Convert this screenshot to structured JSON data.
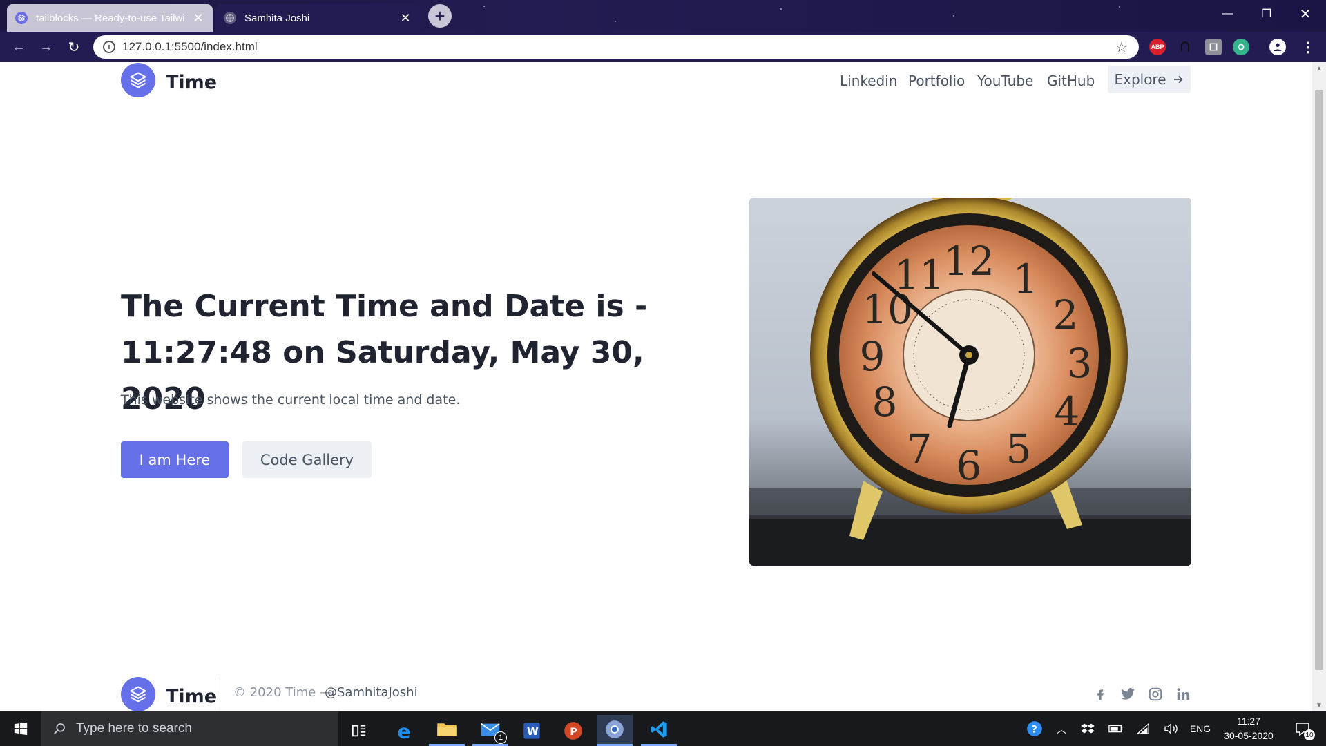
{
  "browser": {
    "tabs": [
      {
        "title": "tailblocks — Ready-to-use Tailwi",
        "active": false
      },
      {
        "title": "Samhita Joshi",
        "active": true
      }
    ],
    "url": "127.0.0.1:5500/index.html",
    "extensions": [
      {
        "name": "adblock-plus-icon",
        "label": "ABP"
      }
    ]
  },
  "header": {
    "brand": "Time",
    "nav": [
      "Linkedin",
      "Portfolio",
      "YouTube",
      "GitHub"
    ],
    "explore_label": "Explore",
    "explore_icon": "arrow-right-icon"
  },
  "hero": {
    "heading_line1": "The Current Time and Date is -",
    "heading_line2": "11:27:48 on Saturday, May 30, 2020",
    "subtext": "This website shows the current local time and date.",
    "primary_button": "I am Here",
    "secondary_button": "Code Gallery",
    "image_icon": "vintage-alarm-clock-photo"
  },
  "footer": {
    "brand": "Time",
    "copyright": "© 2020 Time —",
    "handle": "@SamhitaJoshi",
    "social": [
      "facebook-icon",
      "twitter-icon",
      "instagram-icon",
      "linkedin-icon"
    ]
  },
  "taskbar": {
    "search_placeholder": "Type here to search",
    "language": "ENG",
    "time": "11:27",
    "date": "30-05-2020",
    "notification_count": "10",
    "mail_badge": "1"
  },
  "colors": {
    "accent": "#6670e8",
    "chrome_bg": "#221c52",
    "text_dark": "#1f2430",
    "text_muted": "#4b5563"
  }
}
